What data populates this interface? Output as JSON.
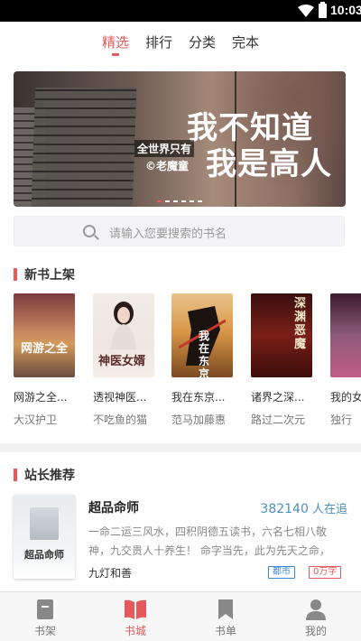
{
  "status_bar": {
    "time": "10:03"
  },
  "top_tabs": [
    {
      "label": "精选",
      "active": true
    },
    {
      "label": "排行",
      "active": false
    },
    {
      "label": "分类",
      "active": false
    },
    {
      "label": "完本",
      "active": false
    }
  ],
  "banner": {
    "title_line1": "我不知道",
    "title_line2": "我是高人",
    "subtitle": "全世界只有",
    "author": "©老魔童",
    "slides": 6,
    "active_slide": 0
  },
  "search": {
    "placeholder": "请输入您要搜索的书名"
  },
  "new_books": {
    "title": "新书上架",
    "items": [
      {
        "title": "网游之全...",
        "author": "大汉护卫",
        "cover_text": "网游之全"
      },
      {
        "title": "透视神医...",
        "author": "不吃鱼的猫",
        "cover_text": "神医女婿"
      },
      {
        "title": "我在东京...",
        "author": "范马加藤惠",
        "cover_text": "我在东京"
      },
      {
        "title": "诸界之深...",
        "author": "路过二次元",
        "cover_text": "深渊恶魔"
      },
      {
        "title": "我的女",
        "author": "独行",
        "cover_text": ""
      }
    ]
  },
  "recommend": {
    "title": "站长推荐",
    "book": {
      "name": "超品命师",
      "readers_count": "382140",
      "readers_suffix": " 人在追",
      "description": "一命二运三风水，四积阴德五读书，六名七相八敬神，九交贵人十养生！ 命字当先，此为先天之命，不...",
      "author": "九灯和善",
      "tags": [
        "都市",
        "0万字"
      ],
      "cover_text": "超品命师"
    }
  },
  "bottom_nav": [
    {
      "label": "书架",
      "active": false
    },
    {
      "label": "书城",
      "active": true
    },
    {
      "label": "书单",
      "active": false
    },
    {
      "label": "我的",
      "active": false
    }
  ],
  "colors": {
    "accent": "#e55a5c",
    "link_blue": "#4a90c2",
    "tag_blue": "#3d88d6",
    "inactive_icon": "#888888"
  }
}
